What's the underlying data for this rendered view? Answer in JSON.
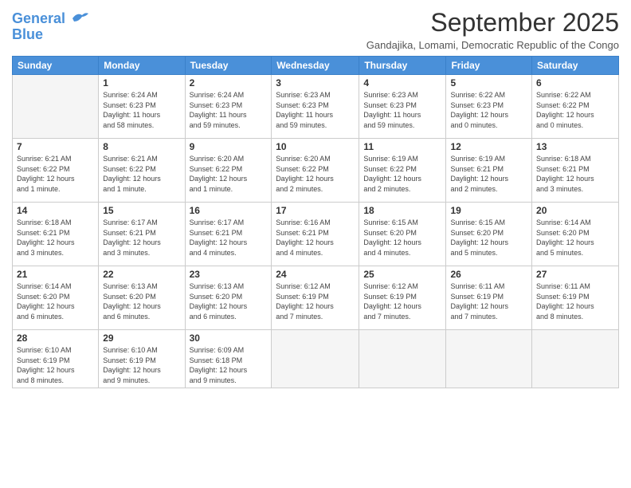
{
  "logo": {
    "line1": "General",
    "line2": "Blue"
  },
  "title": "September 2025",
  "location": "Gandajika, Lomami, Democratic Republic of the Congo",
  "days_of_week": [
    "Sunday",
    "Monday",
    "Tuesday",
    "Wednesday",
    "Thursday",
    "Friday",
    "Saturday"
  ],
  "weeks": [
    [
      {
        "day": "",
        "info": ""
      },
      {
        "day": "1",
        "info": "Sunrise: 6:24 AM\nSunset: 6:23 PM\nDaylight: 11 hours\nand 58 minutes."
      },
      {
        "day": "2",
        "info": "Sunrise: 6:24 AM\nSunset: 6:23 PM\nDaylight: 11 hours\nand 59 minutes."
      },
      {
        "day": "3",
        "info": "Sunrise: 6:23 AM\nSunset: 6:23 PM\nDaylight: 11 hours\nand 59 minutes."
      },
      {
        "day": "4",
        "info": "Sunrise: 6:23 AM\nSunset: 6:23 PM\nDaylight: 11 hours\nand 59 minutes."
      },
      {
        "day": "5",
        "info": "Sunrise: 6:22 AM\nSunset: 6:23 PM\nDaylight: 12 hours\nand 0 minutes."
      },
      {
        "day": "6",
        "info": "Sunrise: 6:22 AM\nSunset: 6:22 PM\nDaylight: 12 hours\nand 0 minutes."
      }
    ],
    [
      {
        "day": "7",
        "info": "Sunrise: 6:21 AM\nSunset: 6:22 PM\nDaylight: 12 hours\nand 1 minute."
      },
      {
        "day": "8",
        "info": "Sunrise: 6:21 AM\nSunset: 6:22 PM\nDaylight: 12 hours\nand 1 minute."
      },
      {
        "day": "9",
        "info": "Sunrise: 6:20 AM\nSunset: 6:22 PM\nDaylight: 12 hours\nand 1 minute."
      },
      {
        "day": "10",
        "info": "Sunrise: 6:20 AM\nSunset: 6:22 PM\nDaylight: 12 hours\nand 2 minutes."
      },
      {
        "day": "11",
        "info": "Sunrise: 6:19 AM\nSunset: 6:22 PM\nDaylight: 12 hours\nand 2 minutes."
      },
      {
        "day": "12",
        "info": "Sunrise: 6:19 AM\nSunset: 6:21 PM\nDaylight: 12 hours\nand 2 minutes."
      },
      {
        "day": "13",
        "info": "Sunrise: 6:18 AM\nSunset: 6:21 PM\nDaylight: 12 hours\nand 3 minutes."
      }
    ],
    [
      {
        "day": "14",
        "info": "Sunrise: 6:18 AM\nSunset: 6:21 PM\nDaylight: 12 hours\nand 3 minutes."
      },
      {
        "day": "15",
        "info": "Sunrise: 6:17 AM\nSunset: 6:21 PM\nDaylight: 12 hours\nand 3 minutes."
      },
      {
        "day": "16",
        "info": "Sunrise: 6:17 AM\nSunset: 6:21 PM\nDaylight: 12 hours\nand 4 minutes."
      },
      {
        "day": "17",
        "info": "Sunrise: 6:16 AM\nSunset: 6:21 PM\nDaylight: 12 hours\nand 4 minutes."
      },
      {
        "day": "18",
        "info": "Sunrise: 6:15 AM\nSunset: 6:20 PM\nDaylight: 12 hours\nand 4 minutes."
      },
      {
        "day": "19",
        "info": "Sunrise: 6:15 AM\nSunset: 6:20 PM\nDaylight: 12 hours\nand 5 minutes."
      },
      {
        "day": "20",
        "info": "Sunrise: 6:14 AM\nSunset: 6:20 PM\nDaylight: 12 hours\nand 5 minutes."
      }
    ],
    [
      {
        "day": "21",
        "info": "Sunrise: 6:14 AM\nSunset: 6:20 PM\nDaylight: 12 hours\nand 6 minutes."
      },
      {
        "day": "22",
        "info": "Sunrise: 6:13 AM\nSunset: 6:20 PM\nDaylight: 12 hours\nand 6 minutes."
      },
      {
        "day": "23",
        "info": "Sunrise: 6:13 AM\nSunset: 6:20 PM\nDaylight: 12 hours\nand 6 minutes."
      },
      {
        "day": "24",
        "info": "Sunrise: 6:12 AM\nSunset: 6:19 PM\nDaylight: 12 hours\nand 7 minutes."
      },
      {
        "day": "25",
        "info": "Sunrise: 6:12 AM\nSunset: 6:19 PM\nDaylight: 12 hours\nand 7 minutes."
      },
      {
        "day": "26",
        "info": "Sunrise: 6:11 AM\nSunset: 6:19 PM\nDaylight: 12 hours\nand 7 minutes."
      },
      {
        "day": "27",
        "info": "Sunrise: 6:11 AM\nSunset: 6:19 PM\nDaylight: 12 hours\nand 8 minutes."
      }
    ],
    [
      {
        "day": "28",
        "info": "Sunrise: 6:10 AM\nSunset: 6:19 PM\nDaylight: 12 hours\nand 8 minutes."
      },
      {
        "day": "29",
        "info": "Sunrise: 6:10 AM\nSunset: 6:19 PM\nDaylight: 12 hours\nand 9 minutes."
      },
      {
        "day": "30",
        "info": "Sunrise: 6:09 AM\nSunset: 6:18 PM\nDaylight: 12 hours\nand 9 minutes."
      },
      {
        "day": "",
        "info": ""
      },
      {
        "day": "",
        "info": ""
      },
      {
        "day": "",
        "info": ""
      },
      {
        "day": "",
        "info": ""
      }
    ]
  ]
}
